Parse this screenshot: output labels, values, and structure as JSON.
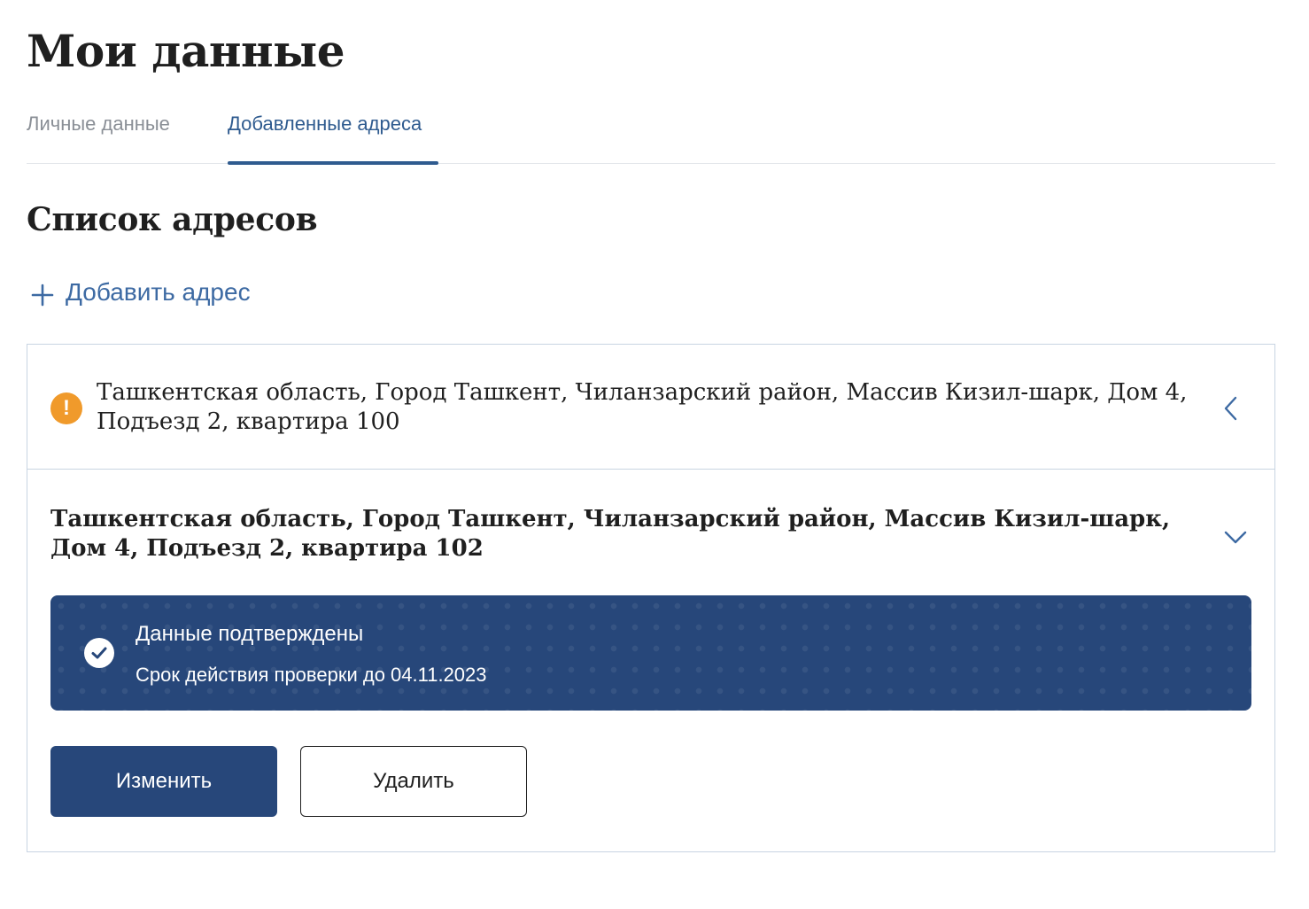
{
  "page": {
    "title": "Мои данные"
  },
  "tabs": [
    {
      "label": "Личные данные",
      "active": false
    },
    {
      "label": "Добавленные адреса",
      "active": true
    }
  ],
  "section": {
    "title": "Список адресов",
    "add_button_label": "Добавить адрес"
  },
  "addresses": [
    {
      "text": "Ташкентская область, Город Ташкент, Чиланзарский район, Массив Кизил-шарк, Дом 4, Подъезд 2, квартира 100",
      "status_icon": "warning-icon",
      "expanded": false,
      "chevron_icon": "chevron-left-icon"
    },
    {
      "text": "Ташкентская область, Город Ташкент, Чиланзарский район, Массив Кизил-шарк, Дом 4, Подъезд 2, квартира 102",
      "expanded": true,
      "chevron_icon": "chevron-down-icon",
      "status": {
        "icon": "check-icon",
        "title": "Данные подтверждены",
        "subtitle": "Срок действия проверки до 04.11.2023"
      },
      "actions": {
        "edit_label": "Изменить",
        "delete_label": "Удалить"
      }
    }
  ],
  "colors": {
    "primary": "#27477a",
    "link": "#3d6aa3",
    "warning": "#f09a2b",
    "border": "#c8d4e2",
    "tab_inactive": "#8a8f96"
  }
}
